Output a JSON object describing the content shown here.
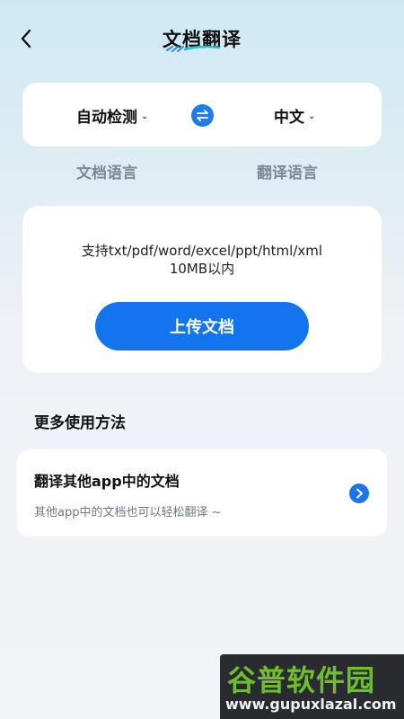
{
  "header": {
    "title": "文档翻译"
  },
  "language": {
    "source": "自动检测",
    "target": "中文",
    "source_caption": "文档语言",
    "target_caption": "翻译语言"
  },
  "upload": {
    "support_line1": "支持txt/pdf/word/excel/ppt/html/xml",
    "support_line2": "10MB以内",
    "button_label": "上传文档"
  },
  "more": {
    "section_title": "更多使用方法",
    "items": [
      {
        "title": "翻译其他app中的文档",
        "description": "其他app中的文档也可以轻松翻译 ~"
      }
    ]
  },
  "watermark": {
    "brand": "谷普软件园",
    "url": "www.gupuxlazal.com"
  },
  "colors": {
    "accent": "#1274ee",
    "muted_text": "#7d8a96",
    "watermark_green": "#6fbf2a"
  }
}
